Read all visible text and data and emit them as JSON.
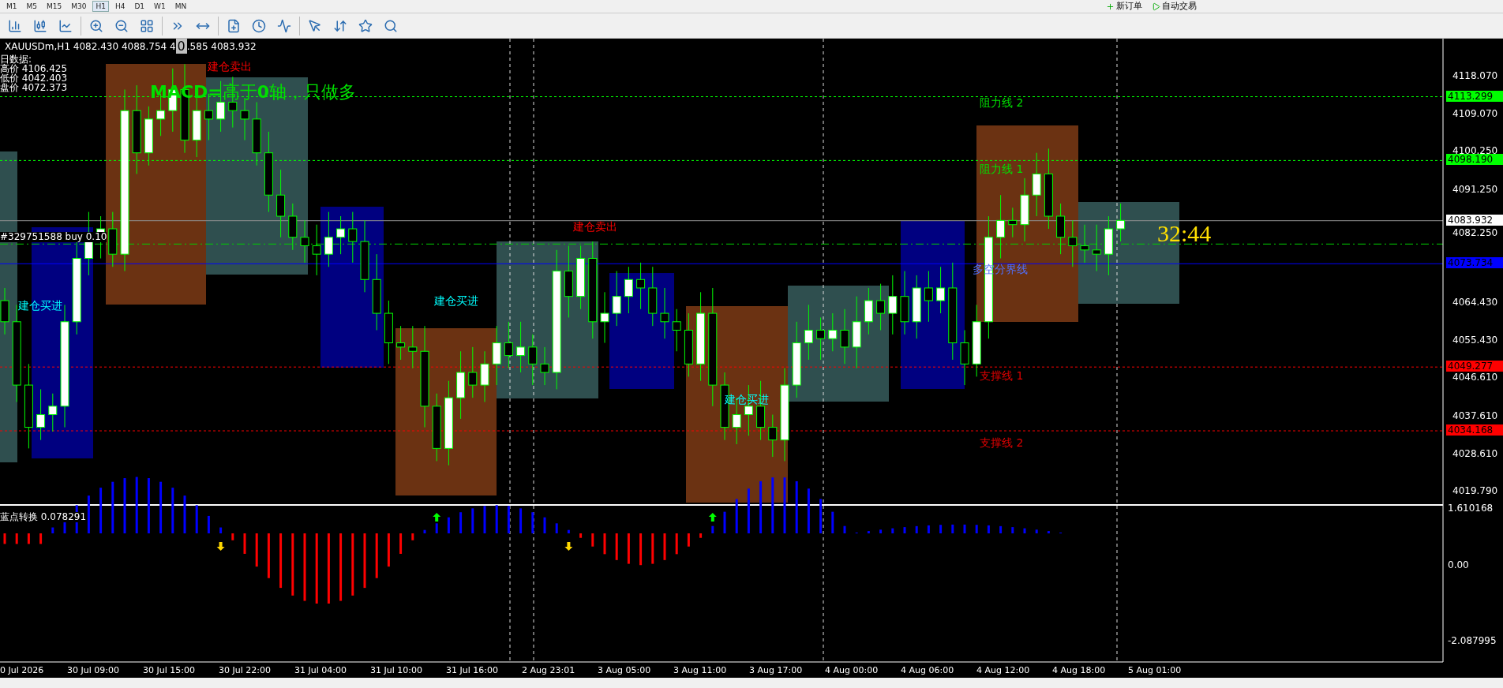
{
  "toolbar": {
    "timeframes": [
      {
        "label": "M1",
        "selected": false
      },
      {
        "label": "M5",
        "selected": false
      },
      {
        "label": "M15",
        "selected": false
      },
      {
        "label": "M30",
        "selected": false
      },
      {
        "label": "H1",
        "selected": true
      },
      {
        "label": "H4",
        "selected": false
      },
      {
        "label": "D1",
        "selected": false
      },
      {
        "label": "W1",
        "selected": false
      },
      {
        "label": "MN",
        "selected": false
      }
    ],
    "buttons": [
      {
        "label": "新订单",
        "kind": "order"
      },
      {
        "label": "自动交易",
        "kind": "auto"
      }
    ]
  },
  "chart": {
    "title": "XAUUSDm,H1 4082.430 4088.754 4",
    "cursor_char": "0",
    "title_rest": ".585 4083.932",
    "info_lines": [
      "日数据:",
      "高价 4106.425",
      "低价 4042.403",
      "盘价 4072.373"
    ],
    "signal_banner": "**MACD=**高于**0**轴，只做多",
    "annotations": [
      {
        "text": "建仓卖出",
        "kind": "sell"
      },
      {
        "text": "建仓卖出",
        "kind": "sell"
      },
      {
        "text": "建仓买进",
        "kind": "buy"
      },
      {
        "text": "建仓买进",
        "kind": "buy"
      },
      {
        "text": "建仓买进",
        "kind": "buy"
      }
    ],
    "order_label": "#329751588 buy 0.10",
    "level_labels": [
      {
        "text": "阻力线 2",
        "kind": "resistance"
      },
      {
        "text": "阻力线 1",
        "kind": "resistance"
      },
      {
        "text": "多空分界线",
        "kind": "divider"
      },
      {
        "text": "支撑线 1",
        "kind": "support"
      },
      {
        "text": "支撑线 2",
        "kind": "support"
      }
    ],
    "countdown": "32:44",
    "price_ticks": [
      "4118.070",
      "4109.070",
      "4100.250",
      "4091.250",
      "4082.250",
      "4064.430",
      "4055.430",
      "4046.610",
      "4037.610",
      "4028.610",
      "4019.790"
    ],
    "price_markers": [
      {
        "text": "4113.299",
        "color": "#00ff00"
      },
      {
        "text": "4098.190",
        "color": "#00ff00"
      },
      {
        "text": "4083.932",
        "color": "#ffffff"
      },
      {
        "text": "4073.734",
        "color": "#0000ff"
      },
      {
        "text": "4049.277",
        "color": "#ff0000"
      },
      {
        "text": "4034.168",
        "color": "#ff0000"
      }
    ]
  },
  "indicator": {
    "label": "蓝点转换 0.078291",
    "ticks": [
      "1.610168",
      "0.00",
      "-2.087995"
    ]
  },
  "time_axis": [
    "0 Jul 2026",
    "30 Jul 09:00",
    "30 Jul 15:00",
    "30 Jul 22:00",
    "31 Jul 04:00",
    "31 Jul 10:00",
    "31 Jul 16:00",
    "2 Aug 23:01",
    "3 Aug 05:00",
    "3 Aug 11:00",
    "3 Aug 17:00",
    "4 Aug 00:00",
    "4 Aug 06:00",
    "4 Aug 12:00",
    "4 Aug 18:00",
    "5 Aug 01:00"
  ]
}
